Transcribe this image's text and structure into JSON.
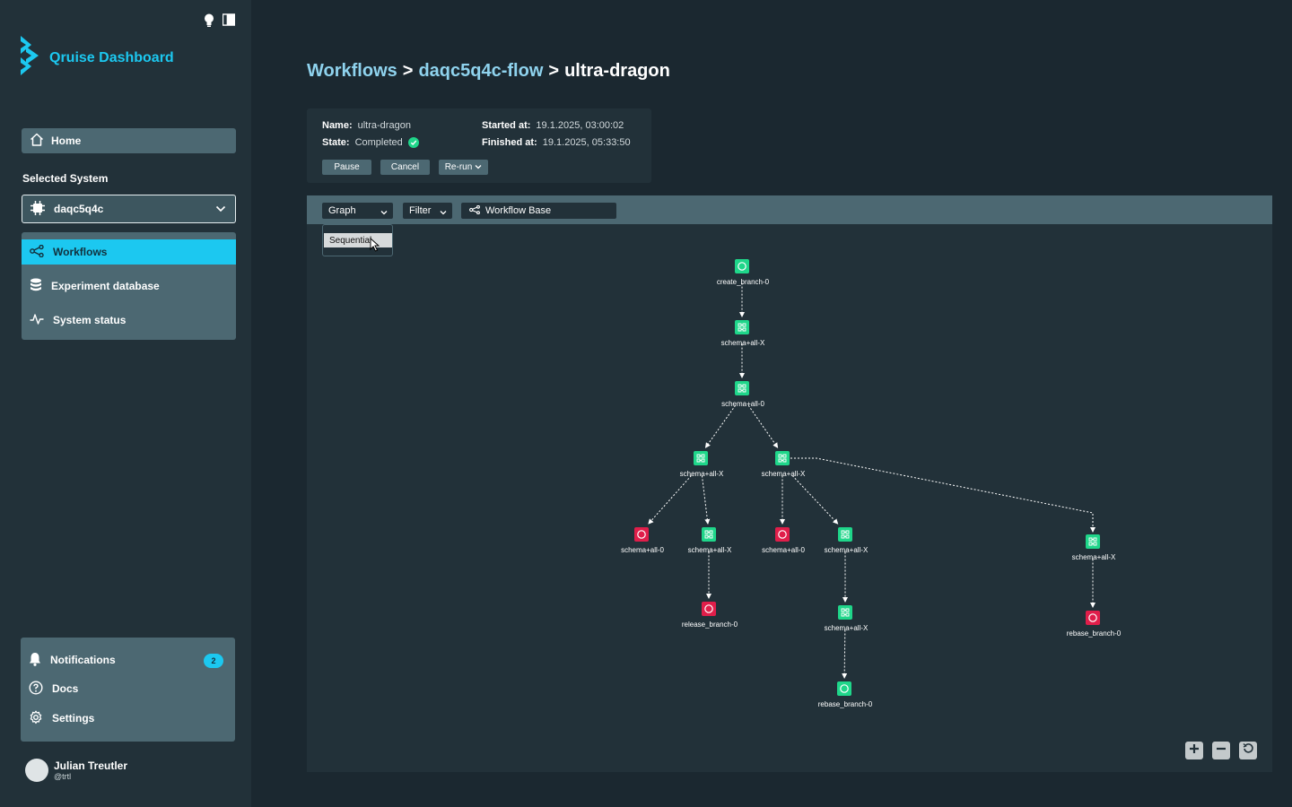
{
  "app": {
    "title": "Qruise Dashboard"
  },
  "sidebar": {
    "home_label": "Home",
    "selected_system_label": "Selected System",
    "system_value": "daqc5q4c",
    "nav": [
      {
        "label": "Workflows",
        "icon": "workflow-icon",
        "active": true
      },
      {
        "label": "Experiment database",
        "icon": "database-icon",
        "active": false
      },
      {
        "label": "System status",
        "icon": "activity-icon",
        "active": false
      }
    ],
    "bottom": [
      {
        "label": "Notifications",
        "icon": "bell-icon",
        "badge": "2"
      },
      {
        "label": "Docs",
        "icon": "help-icon"
      },
      {
        "label": "Settings",
        "icon": "gear-icon"
      }
    ],
    "user": {
      "name": "Julian Treutler",
      "handle": "@trtl"
    }
  },
  "breadcrumb": {
    "root": "Workflows",
    "flow": "daqc5q4c-flow",
    "current": "ultra-dragon",
    "sep": ">"
  },
  "info": {
    "name_label": "Name:",
    "name_value": "ultra-dragon",
    "state_label": "State:",
    "state_value": "Completed",
    "started_label": "Started at:",
    "started_value": "19.1.2025, 03:00:02",
    "finished_label": "Finished at:",
    "finished_value": "19.1.2025, 05:33:50",
    "buttons": {
      "pause": "Pause",
      "cancel": "Cancel",
      "rerun": "Re-run"
    }
  },
  "toolbar": {
    "view": "Graph",
    "filter": "Filter",
    "base": "Workflow Base",
    "dropdown_option": "Sequential"
  },
  "colors": {
    "accent": "#1cc8f0",
    "success": "#1fd68a",
    "error": "#e01e4a"
  },
  "graph": {
    "nodes": [
      {
        "id": "n0",
        "label": "create_branch-0",
        "status": "success",
        "kind": "branch"
      },
      {
        "id": "n1",
        "label": "schema+all-X",
        "status": "success",
        "kind": "schema"
      },
      {
        "id": "n2",
        "label": "schema+all-0",
        "status": "success",
        "kind": "schema"
      },
      {
        "id": "n3",
        "label": "schema+all-X",
        "status": "success",
        "kind": "schema"
      },
      {
        "id": "n4",
        "label": "schema+all-X",
        "status": "success",
        "kind": "schema"
      },
      {
        "id": "n5",
        "label": "schema+all-0",
        "status": "error",
        "kind": "branch"
      },
      {
        "id": "n6",
        "label": "schema+all-X",
        "status": "success",
        "kind": "schema"
      },
      {
        "id": "n7",
        "label": "schema+all-0",
        "status": "error",
        "kind": "branch"
      },
      {
        "id": "n8",
        "label": "schema+all-X",
        "status": "success",
        "kind": "schema"
      },
      {
        "id": "n9",
        "label": "schema+all-X",
        "status": "success",
        "kind": "schema"
      },
      {
        "id": "n10",
        "label": "release_branch-0",
        "status": "error",
        "kind": "branch"
      },
      {
        "id": "n11",
        "label": "schema+all-X",
        "status": "success",
        "kind": "schema"
      },
      {
        "id": "n12",
        "label": "rebase_branch-0",
        "status": "success",
        "kind": "branch"
      },
      {
        "id": "n13",
        "label": "rebase_branch-0",
        "status": "error",
        "kind": "branch"
      }
    ],
    "edges": [
      [
        "n0",
        "n1"
      ],
      [
        "n1",
        "n2"
      ],
      [
        "n2",
        "n3"
      ],
      [
        "n2",
        "n4"
      ],
      [
        "n3",
        "n5"
      ],
      [
        "n3",
        "n6"
      ],
      [
        "n4",
        "n7"
      ],
      [
        "n4",
        "n8"
      ],
      [
        "n4",
        "n9"
      ],
      [
        "n6",
        "n10"
      ],
      [
        "n8",
        "n11"
      ],
      [
        "n11",
        "n12"
      ],
      [
        "n9",
        "n13"
      ]
    ]
  }
}
